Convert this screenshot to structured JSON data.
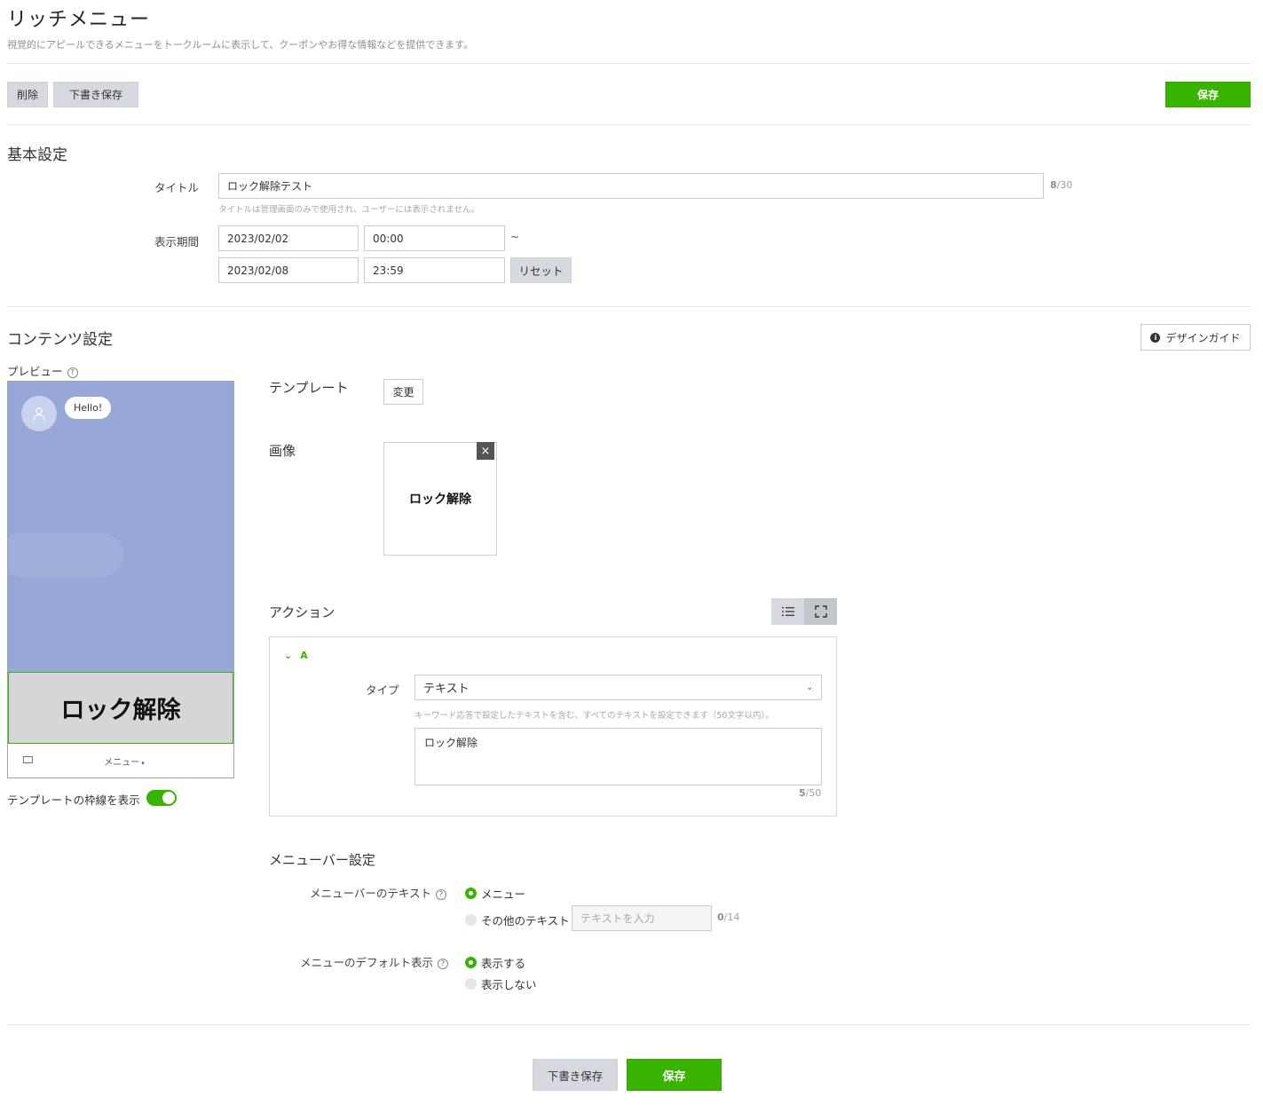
{
  "header": {
    "title": "リッチメニュー",
    "description": "視覚的にアピールできるメニューをトークルームに表示して、クーポンやお得な情報などを提供できます。"
  },
  "toolbar": {
    "delete_label": "削除",
    "draft_label": "下書き保存",
    "save_label": "保存"
  },
  "basic": {
    "section_title": "基本設定",
    "title_label": "タイトル",
    "title_value": "ロック解除テスト",
    "title_counter_current": "8",
    "title_counter_max": "/30",
    "title_hint": "タイトルは管理画面のみで使用され、ユーザーには表示されません。",
    "period_label": "表示期間",
    "start_date": "2023/02/02",
    "start_time": "00:00",
    "tilde": "~",
    "end_date": "2023/02/08",
    "end_time": "23:59",
    "reset_label": "リセット"
  },
  "content": {
    "section_title": "コンテンツ設定",
    "design_guide_label": "デザインガイド",
    "preview_label": "プレビュー",
    "preview": {
      "bubble_text": "Hello!",
      "menu_image_text": "ロック解除",
      "menubar_text": "メニュー",
      "chat_bg": "#97a8d8"
    },
    "border_toggle_label": "テンプレートの枠線を表示",
    "template_label": "テンプレート",
    "change_label": "変更",
    "image_label": "画像",
    "image_text": "ロック解除",
    "action_label": "アクション",
    "action": {
      "area_letter": "A",
      "type_label": "タイプ",
      "type_value": "テキスト",
      "type_hint": "キーワード応答で設定したテキストを含む、すべてのテキストを設定できます（50文字以内）。",
      "text_value": "ロック解除",
      "counter_current": "5",
      "counter_max": "/50"
    }
  },
  "menubar": {
    "section_title": "メニューバー設定",
    "text_label": "メニューバーのテキスト",
    "option_menu": "メニュー",
    "option_other": "その他のテキスト",
    "other_placeholder": "テキストを入力",
    "other_counter_current": "0",
    "other_counter_max": "/14",
    "default_label": "メニューのデフォルト表示",
    "option_show": "表示する",
    "option_hide": "表示しない"
  },
  "footer": {
    "draft_label": "下書き保存",
    "save_label": "保存"
  },
  "colors": {
    "accent_green": "#37b300",
    "gray_button": "#d6d9df"
  }
}
